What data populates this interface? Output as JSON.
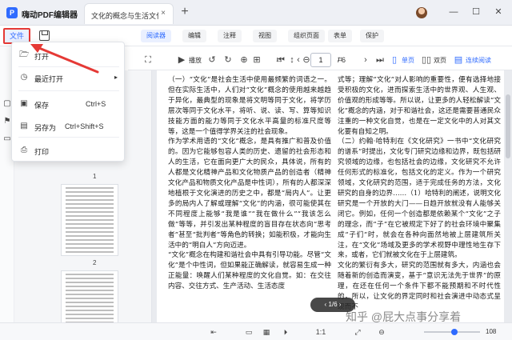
{
  "app": {
    "title": "嗨动PDF编辑器",
    "logo_letter": "P"
  },
  "tabs": [
    {
      "label": "文化的概念与生活文化...",
      "close": "×"
    }
  ],
  "new_tab": "+",
  "window": {
    "minimize": "—",
    "maximize": "☐",
    "close": "✕"
  },
  "menubar": {
    "file": "文件",
    "tabs": [
      "阅读器",
      "编辑",
      "注释",
      "视图",
      "组织页面",
      "表单",
      "保护"
    ],
    "active_tab": "阅读器"
  },
  "toolbar": {
    "play_label": "播放",
    "current_page": "1",
    "total_pages": "/ 6",
    "single_page": "单页",
    "double_page": "双页",
    "continuous": "连续阅读"
  },
  "file_dropdown": {
    "items": [
      {
        "icon": "folder-open-icon",
        "label": "打开",
        "shortcut": ""
      },
      {
        "icon": "clock-icon",
        "label": "最近打开",
        "shortcut": "",
        "has_submenu": true
      },
      {
        "icon": "save-icon",
        "label": "保存",
        "shortcut": "Ctrl+S"
      },
      {
        "icon": "save-as-icon",
        "label": "另存为",
        "shortcut": "Ctrl+Shift+S"
      },
      {
        "icon": "print-icon",
        "label": "打印",
        "shortcut": ""
      }
    ]
  },
  "thumbnails": {
    "page_numbers": [
      "1",
      "2"
    ]
  },
  "document": {
    "left_column": [
      "（一）“文化”是社会生活中使用最频繁的词语之一。但在实际生活中，人们对“文化”概念的使用越来越趋于异化，最典型的现象是将文明等同于文化，将学历层次等同于文化水平，将听、说、读、写、算等知识技能方面的能力等同于文化水平高量的标准尺度等等，这是一个值得学界关注的社会现象。",
      "作为学术用语的“文化”概念，是具有推广和普及价值的。因为它能够包容人类的历史、遗留的社会形态和人的生活，它在面向更广大的民众，具体说，所有的人都是文化精神产品和文化物质产品的创造者（精神文化产品和物质文化产品是中性词），所有的人都深深地植根于文化演进的历史之中，都是“局内人”。让更多的局内人了解或理解“文化”的内涵，很可能使其在不同程度上能够“我是谁”“我在做什么”“我该怎么做”等等，并引发出某种程度的盲目存在状态向“思考者”甚至“批判者”等角色的转换；如能积极，才能向生活中的“明白人”方向迈进。",
      "“文化”概念在构建和谐社会中具有引导功能。尽管“文化”是个中性词，但如果能正确解读，就容易生成一种正能量：唤醒人们某种程度的文化自觉。如：在交往内容、交往方式、生产活动、生活态度"
    ],
    "right_column": [
      "式等；理解“文化”对人影响的重要性，便有选择地接受积极的文化，进而探索生活中的世界观、人生观、价值观的形成等等。所以说，让更多的人轻松解读“文化”概念的内涵，对于和谐社会，这还是需要普通民众注重的一种文化自觉，也是在一定文化中的人对其文化要有自知之明。",
      "（二）约翰·哈特利在《文化研究》一书中“文化研究的谱系”时提出，文化专门研究边缘和边界，既包括研究领域的边缘，也包括社会的边缘，文化研究不允许任何形式的标准化，包括文化的定义。作为一个研究领域，文化研究的范围，适于完成任务的方法，文化研究的自身的边界……（1）哈特利的阐述，说明文化研究是一个开放的大门——日趋开放就没有人能够关闭它。例如，任何一个创造都是依赖某个“文化”之子的理念，而“子”在它被规定下好了的社会环境中聚集成“子们”时，就会在各种向面然地被上层建筑所关注，在“文化”场域及更多的学术视野中理性地生存下来，或者，它们就被文化在于上层建筑。",
      "文化的繁衍有多大，研究的范围就有多大，内涵也会随着新的创造而演变，基于“意识无法先于世界”的原理，在还在任何一个条件下都不能预期和不时代性的，所以，让文化的界定同时和社会演进中动态式呈现而不"
    ]
  },
  "page_indicator": "1/6",
  "watermark": "知乎 @屁大点事分享着",
  "statusbar": {
    "zoom": "108"
  }
}
